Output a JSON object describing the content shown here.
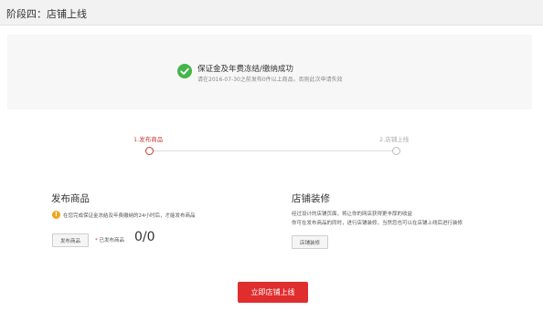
{
  "header": {
    "title": "阶段四：店铺上线"
  },
  "notice": {
    "title": "保证金及年费冻结/缴纳成功",
    "subtitle": "请在2016-07-30之前发布0件以上商品，否则此次申请失效"
  },
  "steps": [
    {
      "label": "1.发布商品",
      "state": "active"
    },
    {
      "label": "2.店铺上线",
      "state": "inactive"
    }
  ],
  "publish_section": {
    "title": "发布商品",
    "warning": "在您完成保证金冻结及年费缴纳的24小时后，才能发布商品",
    "button_label": "发布商品",
    "count_star": "*",
    "count_label": "已发布商品",
    "count_value": "0/0"
  },
  "decor_section": {
    "title": "店铺装修",
    "desc_line1": "经过设计的店铺页面，将让你的网店获得更丰厚的收益",
    "desc_line2": "你可在发布商品的同时，进行店铺装修，当然您也可以在店铺上线后进行装修",
    "button_label": "店铺装修"
  },
  "launch_button": {
    "label": "立即店铺上线"
  },
  "colors": {
    "accent_red": "#e02d2d",
    "success_green": "#44b549",
    "warning_orange": "#f0a51e"
  },
  "icons": {
    "success": "check-circle-icon",
    "warning": "warning-icon"
  }
}
